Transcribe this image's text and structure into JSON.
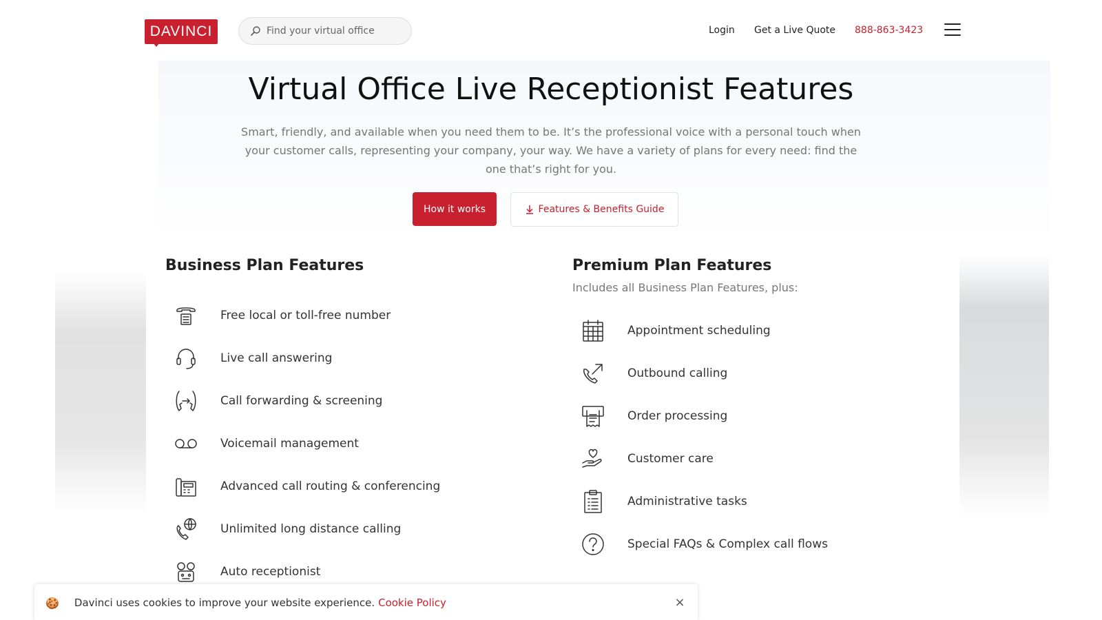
{
  "header": {
    "logo_text": "DAVINCI",
    "search_placeholder": "Find your virtual office",
    "login": "Login",
    "quote": "Get a Live Quote",
    "phone": "888-863-3423"
  },
  "hero": {
    "title": "Virtual Office Live Receptionist Features",
    "subtitle": "Smart, friendly, and available when you need them to be. It’s the professional voice with a personal touch when your customer calls, representing your company, your way. We have a variety of plans for every need: find the one that’s right for you.",
    "primary_button": "How it works",
    "secondary_button": "Features & Benefits Guide"
  },
  "business": {
    "title": "Business Plan Features",
    "items": [
      {
        "label": "Free local or toll-free number",
        "icon": "telephone-icon"
      },
      {
        "label": "Live call answering",
        "icon": "headset-icon"
      },
      {
        "label": "Call forwarding & screening",
        "icon": "call-forward-icon"
      },
      {
        "label": "Voicemail management",
        "icon": "voicemail-icon"
      },
      {
        "label": "Advanced call routing & conferencing",
        "icon": "desk-phone-icon"
      },
      {
        "label": "Unlimited long distance calling",
        "icon": "phone-globe-icon"
      },
      {
        "label": "Auto receptionist",
        "icon": "robot-icon"
      }
    ]
  },
  "premium": {
    "title": "Premium Plan Features",
    "subtitle": "Includes all Business Plan Features, plus:",
    "items": [
      {
        "label": "Appointment scheduling",
        "icon": "calendar-icon"
      },
      {
        "label": "Outbound calling",
        "icon": "outbound-call-icon"
      },
      {
        "label": "Order processing",
        "icon": "receipt-icon"
      },
      {
        "label": "Customer care",
        "icon": "hand-heart-icon"
      },
      {
        "label": "Administrative tasks",
        "icon": "clipboard-icon"
      },
      {
        "label": "Special FAQs & Complex call flows",
        "icon": "question-icon"
      }
    ]
  },
  "cookie": {
    "icon": "cookie-icon",
    "text": "Davinci uses cookies to improve your website experience.",
    "link": "Cookie Policy",
    "close": "×"
  },
  "colors": {
    "brand_red": "#c8202f"
  }
}
